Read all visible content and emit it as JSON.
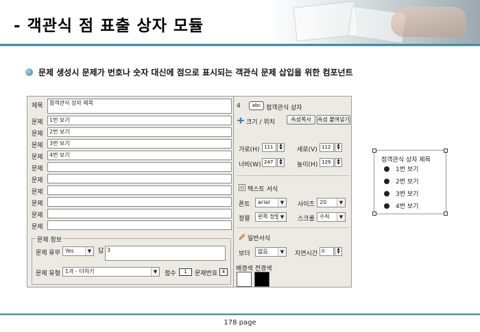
{
  "header": {
    "title": "- 객관식 점 표출 상자 모듈"
  },
  "subtitle": "문제 생성시 문제가 번호나 숫자 대신에 점으로 표시되는 객관식 문제 삽입을 위한 컴포넌트",
  "left_panel": {
    "title_label": "제목",
    "title_value": "점객관식 상자 제목",
    "question_label": "문제",
    "questions": [
      "1번 보기",
      "2번 보기",
      "3번 보기",
      "4번 보기",
      "",
      "",
      "",
      "",
      "",
      ""
    ],
    "group": {
      "title": "문제 정보",
      "presence_label": "문제 유무",
      "presence_value": "Yes",
      "answer_label": "답",
      "answer_value": "3",
      "type_label": "문제 유형",
      "type_value": "1과 - 더하기",
      "score_label": "점수",
      "score_value": "1",
      "number_label": "문제번호",
      "number_value": "4"
    }
  },
  "right_panel": {
    "count": "4",
    "badge_text": "abc",
    "component_name": "점객관식 상자",
    "size_section": "크기 / 위치",
    "copy_props_btn": "속성복사",
    "paste_props_btn": "속성 붙여넣기",
    "x_label": "가로(H)",
    "x_value": "111",
    "w_label": "세로(V)",
    "w_value": "112",
    "width_label": "너비(W)",
    "width_value": "247",
    "height_label": "높이(H)",
    "height_value": "129",
    "text_section": "텍스트 서식",
    "font_label": "폰트",
    "font_value": "arial",
    "size_label": "사이즈",
    "size_value": "20",
    "align_label": "정렬",
    "align_value": "왼쪽 정렬",
    "scroll_label": "스크롤",
    "scroll_value": "수직",
    "general_section": "일반서식",
    "border_label": "보더",
    "border_value": "없음",
    "delay_label": "지연시간",
    "delay_value": "0",
    "colors_label": "배경색 전경색",
    "bg_color": "#ffffff",
    "fg_color": "#000000"
  },
  "preview": {
    "title": "점객관식 상자 제목",
    "items": [
      "1번 보기",
      "2번 보기",
      "3번 보기",
      "4번 보기"
    ]
  },
  "footer": {
    "page": "178 page"
  },
  "colors": {
    "accent": "#3f8fa0",
    "panel_bg": "#eceae3"
  }
}
